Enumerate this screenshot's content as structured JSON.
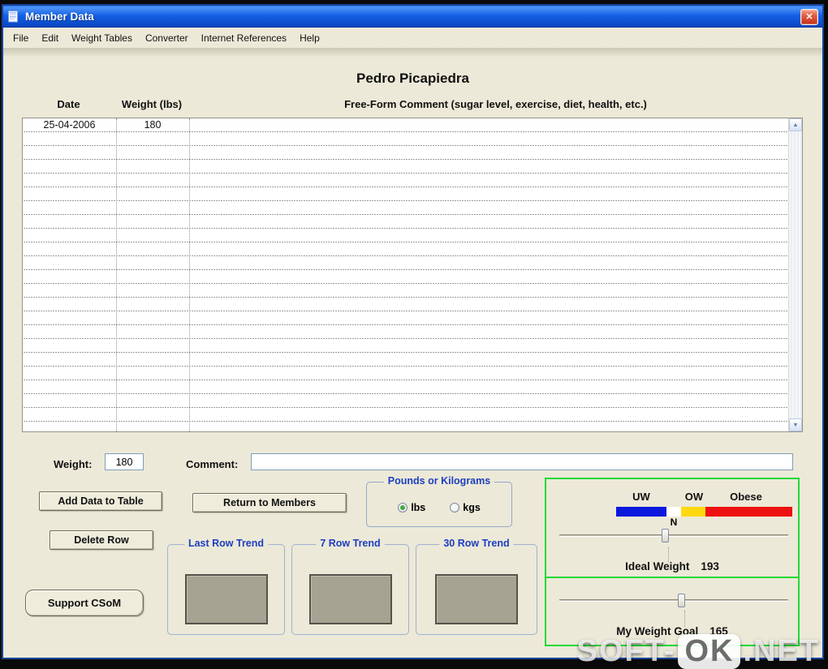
{
  "window": {
    "title": "Member Data",
    "close_glyph": "✕"
  },
  "menu": {
    "items": [
      "File",
      "Edit",
      "Weight Tables",
      "Converter",
      "Internet References",
      "Help"
    ]
  },
  "member": {
    "name": "Pedro Picapiedra"
  },
  "table": {
    "headers": {
      "date": "Date",
      "weight": "Weight (lbs)",
      "comment": "Free-Form Comment (sugar level, exercise, diet, health, etc.)"
    },
    "rows": [
      {
        "date": "25-04-2006",
        "weight": "180",
        "comment": ""
      }
    ]
  },
  "form": {
    "weight_label": "Weight:",
    "weight_value": "180",
    "comment_label": "Comment:",
    "comment_value": ""
  },
  "buttons": {
    "add_data": "Add Data to Table",
    "return_members": "Return to Members",
    "delete_row": "Delete Row",
    "support": "Support CSoM"
  },
  "units": {
    "title": "Pounds or Kilograms",
    "options": [
      {
        "label": "lbs",
        "selected": true
      },
      {
        "label": "kgs",
        "selected": false
      }
    ]
  },
  "trends": {
    "last": "Last Row Trend",
    "seven": "7 Row Trend",
    "thirty": "30 Row Trend"
  },
  "weight_panel": {
    "labels": {
      "uw": "UW",
      "n": "N",
      "ow": "OW",
      "obese": "Obese"
    },
    "ideal_label": "Ideal Weight",
    "ideal_value": "193",
    "goal_label": "My Weight Goal",
    "goal_value": "165",
    "bar_colors": {
      "uw": "#0b18dd",
      "n": "#ffffff",
      "ow": "#ffd90f",
      "obese": "#ee1111"
    },
    "panel_border_color": "#21d938"
  },
  "icons": {
    "up": "▲",
    "down": "▼"
  },
  "watermark": {
    "part1": "SOFT-",
    "part2": "OK",
    "part3": ".NET"
  },
  "colors": {
    "titlebar": "#1460e6",
    "group_title": "#1d3ec0",
    "background": "#ece9d8"
  }
}
